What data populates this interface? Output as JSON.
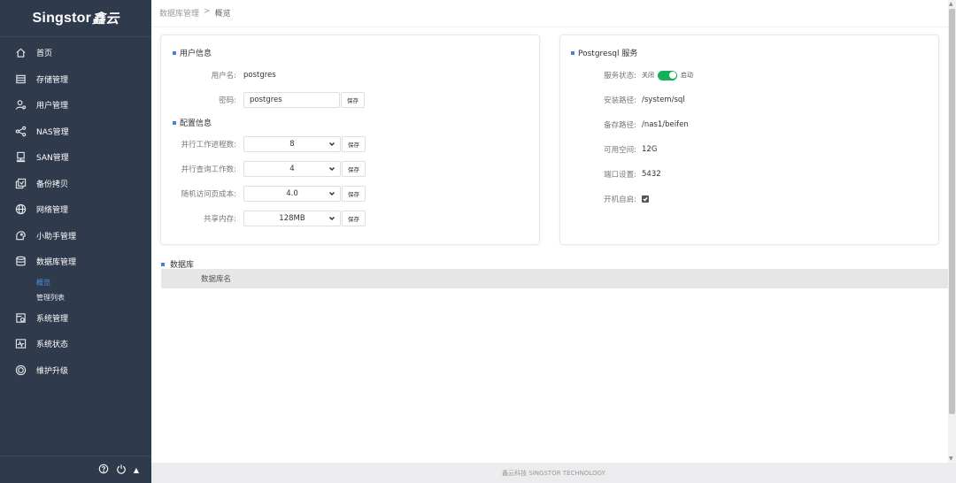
{
  "logo": {
    "en": "Singstor",
    "cn": "鑫云"
  },
  "nav": [
    {
      "label": "首页",
      "icon": "home-icon"
    },
    {
      "label": "存储管理",
      "icon": "storage-icon"
    },
    {
      "label": "用户管理",
      "icon": "users-icon"
    },
    {
      "label": "NAS管理",
      "icon": "share-icon"
    },
    {
      "label": "SAN管理",
      "icon": "san-icon"
    },
    {
      "label": "备份拷贝",
      "icon": "backup-icon"
    },
    {
      "label": "网络管理",
      "icon": "globe-icon"
    },
    {
      "label": "小助手管理",
      "icon": "assistant-icon"
    },
    {
      "label": "数据库管理",
      "icon": "database-icon"
    }
  ],
  "sub_nav": [
    {
      "label": "概览",
      "active": true
    },
    {
      "label": "管理列表",
      "active": false
    }
  ],
  "nav_bottom": [
    {
      "label": "系统管理",
      "icon": "system-icon"
    },
    {
      "label": "系统状态",
      "icon": "monitor-icon"
    },
    {
      "label": "维护升级",
      "icon": "upgrade-icon"
    }
  ],
  "side_footer": {
    "help_icon": "help-icon",
    "power_icon": "power-icon",
    "arrow": "▲"
  },
  "breadcrumb": {
    "parent": "数据库管理",
    "sep": ">",
    "current": "概览"
  },
  "user_info": {
    "title": "用户信息",
    "username_label": "用户名:",
    "username_value": "postgres",
    "password_label": "密码:",
    "password_value": "postgres",
    "save_label": "保存"
  },
  "config_info": {
    "title": "配置信息",
    "rows": [
      {
        "label": "并行工作进程数:",
        "value": "8",
        "save": "保存"
      },
      {
        "label": "并行查询工作数:",
        "value": "4",
        "save": "保存"
      },
      {
        "label": "随机访问页成本:",
        "value": "4.0",
        "save": "保存"
      },
      {
        "label": "共享内存:",
        "value": "128MB",
        "save": "保存"
      }
    ]
  },
  "service": {
    "title": "Postgresql 服务",
    "status_label": "服务状态:",
    "off_label": "关闭",
    "on_label": "启动",
    "install_label": "安装路径:",
    "install_value": "/system/sql",
    "backup_label": "备存路径:",
    "backup_value": "/nas1/beifen",
    "space_label": "可用空间:",
    "space_value": "12G",
    "port_label": "端口设置:",
    "port_value": "5432",
    "autostart_label": "开机自启:",
    "autostart_checked": true
  },
  "database": {
    "title": "数据库",
    "column": "数据库名"
  },
  "footer": "鑫云科技 SINGSTOR TECHNOLOGY",
  "colors": {
    "sidebar": "#303a4d",
    "accent": "#3b86d8",
    "toggle_on": "#13b25a"
  }
}
